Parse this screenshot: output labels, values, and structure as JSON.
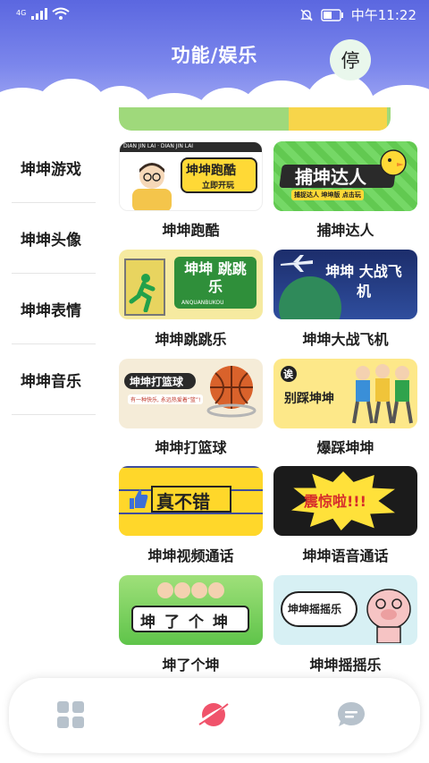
{
  "status_bar": {
    "network": "4G",
    "time": "中午11:22"
  },
  "header": {
    "title": "功能/娱乐",
    "stop_button": "停"
  },
  "categories": [
    {
      "label": "坤坤游戏"
    },
    {
      "label": "坤坤头像"
    },
    {
      "label": "坤坤表情"
    },
    {
      "label": "坤坤音乐"
    }
  ],
  "games": [
    {
      "name": "坤坤跑酷",
      "banner": "坤坤跑酷",
      "banner_sub": "立即开玩",
      "banner_top": "DIAN JIN LAI · DIAN JIN LAI"
    },
    {
      "name": "捕坤达人",
      "banner": "捕坤达人",
      "banner_sub": "捕捉达人 坤坤版 点击玩"
    },
    {
      "name": "坤坤跳跳乐",
      "banner": "坤坤 跳跳乐",
      "banner_sub": "ANQUANBUKOU"
    },
    {
      "name": "坤坤大战飞机",
      "banner": "坤坤 大战飞机"
    },
    {
      "name": "坤坤打篮球",
      "banner": "坤坤打篮球",
      "banner_sub": "有一种快乐, 永远热爱着“篮”!"
    },
    {
      "name": "爆踩坤坤",
      "banner": "别踩坤坤",
      "banner_sub": "诶"
    },
    {
      "name": "坤坤视频通话",
      "banner": "真不错"
    },
    {
      "name": "坤坤语音通话",
      "banner": "震惊啦!!!"
    },
    {
      "name": "坤了个坤",
      "banner": "坤了个坤"
    },
    {
      "name": "坤坤摇摇乐",
      "banner": "坤坤摇摇乐"
    }
  ],
  "nav": {
    "items": [
      "grid-icon",
      "planet-icon",
      "chat-icon"
    ],
    "active_index": 1
  },
  "colors": {
    "header_top": "#5b67e0",
    "nav_active": "#f0536b",
    "nav_inactive": "#b7c2cc"
  }
}
